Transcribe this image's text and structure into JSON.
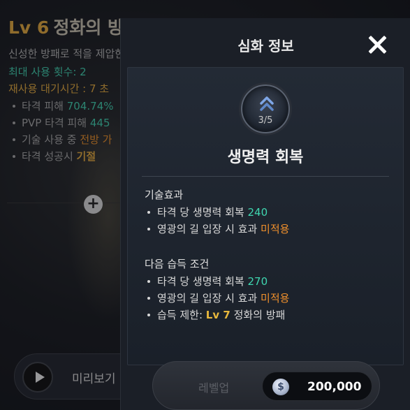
{
  "background": {
    "title_level": "Lv 6",
    "title_name": "정화의 방패",
    "description": "신성한 방패로 적을 제압한다.",
    "max_uses": "최대 사용 횟수: 2",
    "cooldown": "재사용 대기시간 : 7 초",
    "bullets": [
      {
        "label": "타격 피해 ",
        "value": "704.74%"
      },
      {
        "label": "PVP 타격 피해 ",
        "value": "445"
      },
      {
        "label": "기술 사용 중 ",
        "value": "전방 가"
      },
      {
        "label": "타격 성공시 ",
        "value": "기절"
      }
    ],
    "plus_icon": "+",
    "preview_label": "미리보기"
  },
  "modal": {
    "title": "심화 정보",
    "skill": {
      "icon": "double-chevron-up-icon",
      "level": "3/5",
      "name": "생명력 회복"
    },
    "effect_section": {
      "title": "기술효과",
      "items": [
        {
          "label": "타격 당 생명력 회복 ",
          "value": "240",
          "color": "teal"
        },
        {
          "label": "영광의 길 입장 시 효과 ",
          "value": "미적용",
          "color": "orange"
        }
      ]
    },
    "next_section": {
      "title": "다음 습득 조건",
      "items": [
        {
          "label": "타격 당 생명력 회복 ",
          "value": "270",
          "suffix": ""
        },
        {
          "label": "영광의 길 입장 시 효과 ",
          "value": "미적용",
          "suffix": ""
        },
        {
          "label": "습득 제한: ",
          "value": "Lv 7",
          "suffix": " 정화의 방패"
        }
      ]
    },
    "levelup": {
      "label": "레벨업",
      "coin_symbol": "$",
      "cost": "200,000"
    }
  },
  "colors": {
    "teal": "#3fd6b0",
    "orange": "#f0902c",
    "gold": "#e8b83c",
    "title_gold": "#d8a23c"
  }
}
